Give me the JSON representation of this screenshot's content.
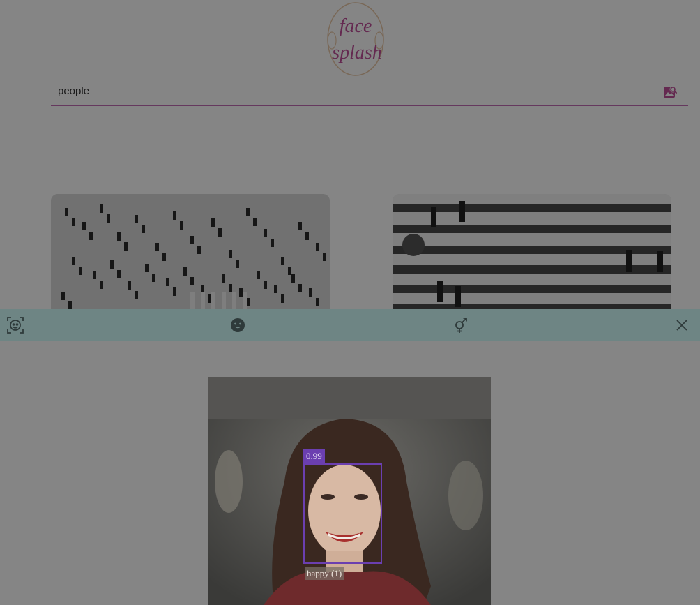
{
  "app": {
    "logo_line1": "face",
    "logo_line2": "splash"
  },
  "search": {
    "value": "people",
    "icon": "image-search-icon"
  },
  "results": [
    {
      "name": "crowd-crossing-photo"
    },
    {
      "name": "crosswalk-pedestrians-photo"
    }
  ],
  "toolbar": {
    "items": [
      {
        "icon": "face-detect-icon"
      },
      {
        "icon": "emotion-smiley-icon"
      },
      {
        "icon": "gender-icon"
      },
      {
        "icon": "close-icon"
      }
    ]
  },
  "detection": {
    "score": "0.99",
    "emotion_label": "happy (1)",
    "box_color": "#6b3fb0"
  },
  "colors": {
    "accent": "#c26bb4",
    "toolbar": "#6e8584"
  }
}
